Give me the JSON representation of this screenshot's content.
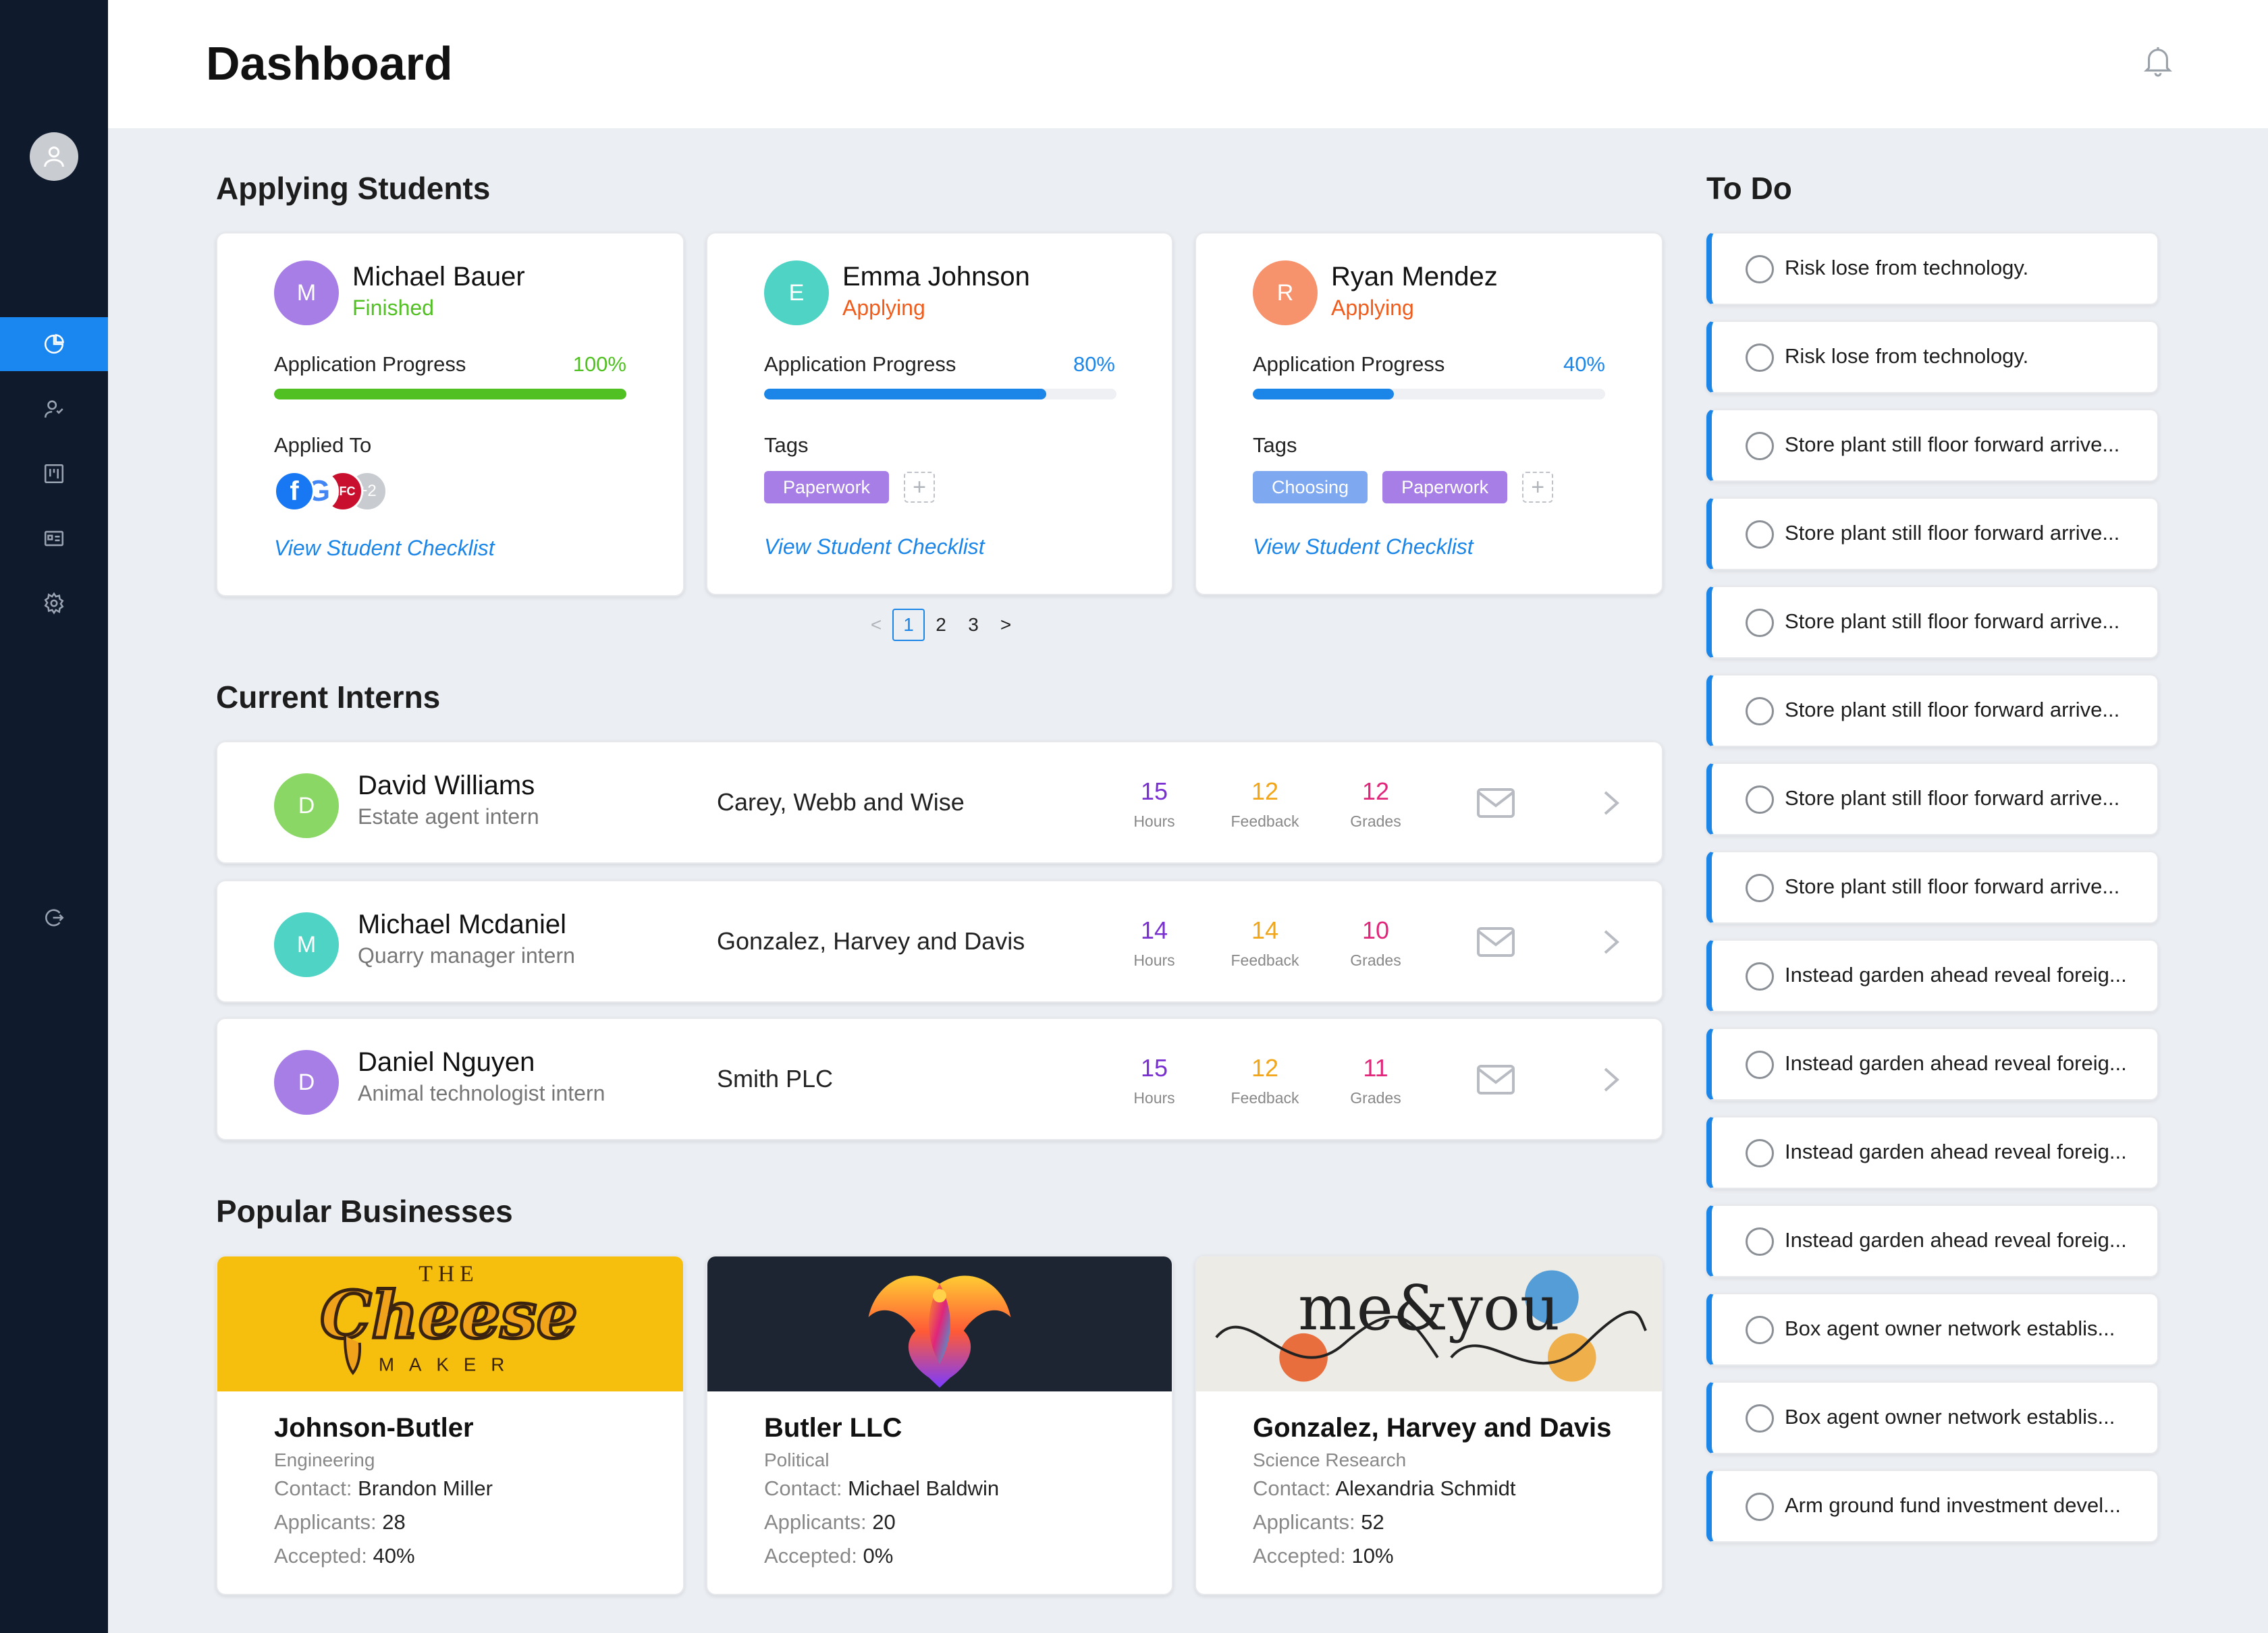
{
  "header": {
    "title": "Dashboard"
  },
  "colors": {
    "sidebar": "#0f1a2d",
    "accent": "#1b86e8",
    "success": "#51c022",
    "warning": "#f05c1c",
    "purple": "#a77ee5"
  },
  "sections": {
    "applying": "Applying Students",
    "interns": "Current Interns",
    "businesses": "Popular Businesses",
    "todo": "To Do"
  },
  "students": [
    {
      "initial": "M",
      "avatar_color": "#a77ee5",
      "name": "Michael Bauer",
      "status": "Finished",
      "status_color": "#51c022",
      "progress_label": "Application Progress",
      "progress": "100%",
      "progress_value": 1.0,
      "bar_color": "#51c022",
      "sub_label": "Applied To",
      "applied_to": [
        "facebook",
        "google",
        "kfc"
      ],
      "applied_more": "+2",
      "link": "View Student Checklist"
    },
    {
      "initial": "E",
      "avatar_color": "#4fd3c4",
      "name": "Emma Johnson",
      "status": "Applying",
      "status_color": "#f05c1c",
      "progress_label": "Application Progress",
      "progress": "80%",
      "progress_value": 0.8,
      "bar_color": "#1b86e8",
      "sub_label": "Tags",
      "tags": [
        {
          "label": "Paperwork",
          "color": "#a77ee5"
        }
      ],
      "link": "View Student Checklist"
    },
    {
      "initial": "R",
      "avatar_color": "#f7936c",
      "name": "Ryan Mendez",
      "status": "Applying",
      "status_color": "#f05c1c",
      "progress_label": "Application Progress",
      "progress": "40%",
      "progress_value": 0.4,
      "bar_color": "#1b86e8",
      "sub_label": "Tags",
      "tags": [
        {
          "label": "Choosing",
          "color": "#7ea8f0"
        },
        {
          "label": "Paperwork",
          "color": "#a77ee5"
        }
      ],
      "link": "View Student Checklist"
    }
  ],
  "pagination": {
    "prev": "<",
    "pages": [
      "1",
      "2",
      "3"
    ],
    "current": "1",
    "next": ">"
  },
  "interns": [
    {
      "initial": "D",
      "avatar_color": "#8ad765",
      "name": "David Williams",
      "role": "Estate agent intern",
      "company": "Carey, Webb and Wise",
      "hours": "15",
      "feedback": "12",
      "grades": "12",
      "hours_label": "Hours",
      "feedback_label": "Feedback",
      "grades_label": "Grades"
    },
    {
      "initial": "M",
      "avatar_color": "#4fd3c4",
      "name": "Michael Mcdaniel",
      "role": "Quarry manager intern",
      "company": "Gonzalez, Harvey and Davis",
      "hours": "14",
      "feedback": "14",
      "grades": "10",
      "hours_label": "Hours",
      "feedback_label": "Feedback",
      "grades_label": "Grades"
    },
    {
      "initial": "D",
      "avatar_color": "#a77ee5",
      "name": "Daniel Nguyen",
      "role": "Animal technologist intern",
      "company": "Smith PLC",
      "hours": "15",
      "feedback": "12",
      "grades": "11",
      "hours_label": "Hours",
      "feedback_label": "Feedback",
      "grades_label": "Grades"
    }
  ],
  "stat_colors": {
    "hours": "#7a2fd1",
    "feedback": "#f2a516",
    "grades": "#e0257a"
  },
  "businesses": [
    {
      "name": "Johnson-Butler",
      "category": "Engineering",
      "contact_label": "Contact:",
      "contact": "Brandon Miller",
      "applicants_label": "Applicants:",
      "applicants": "28",
      "accepted_label": "Accepted:",
      "accepted": "40%",
      "banner_color": "#f6bf0e",
      "logo_text_top": "THE",
      "logo_text_main": "Cheese",
      "logo_text_bottom": "MAKER"
    },
    {
      "name": "Butler LLC",
      "category": "Political",
      "contact_label": "Contact:",
      "contact": "Michael Baldwin",
      "applicants_label": "Applicants:",
      "applicants": "20",
      "accepted_label": "Accepted:",
      "accepted": "0%",
      "banner_color": "#1c2531"
    },
    {
      "name": "Gonzalez, Harvey and Davis",
      "category": "Science Research",
      "contact_label": "Contact:",
      "contact": "Alexandria Schmidt",
      "applicants_label": "Applicants:",
      "applicants": "52",
      "accepted_label": "Accepted:",
      "accepted": "10%",
      "banner_color": "#ecebe6",
      "logo_text": "me&you"
    }
  ],
  "todos": [
    "Risk lose from technology.",
    "Risk lose from technology.",
    "Store plant still floor forward arrive...",
    "Store plant still floor forward arrive...",
    "Store plant still floor forward arrive...",
    "Store plant still floor forward arrive...",
    "Store plant still floor forward arrive...",
    "Store plant still floor forward arrive...",
    "Instead garden ahead reveal foreig...",
    "Instead garden ahead reveal foreig...",
    "Instead garden ahead reveal foreig...",
    "Instead garden ahead reveal foreig...",
    "Box agent owner network establis...",
    "Box agent owner network establis...",
    "Arm ground fund investment devel..."
  ]
}
